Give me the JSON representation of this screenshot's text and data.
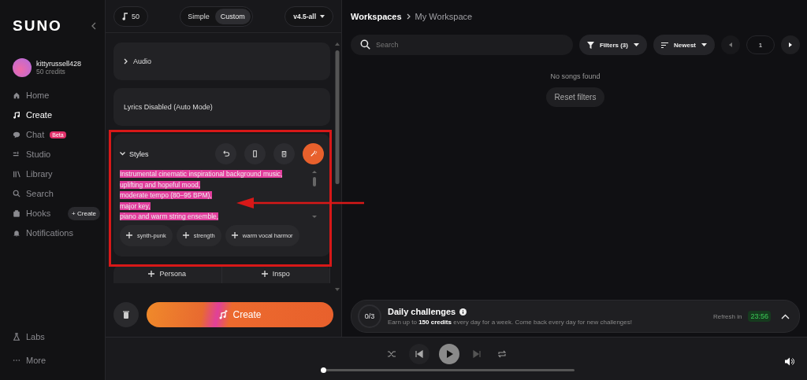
{
  "sidebar": {
    "logo": "SUNO",
    "user": {
      "name": "kittyrussell428",
      "credits": "50 credits"
    },
    "nav": [
      {
        "label": "Home",
        "selected": false
      },
      {
        "label": "Create",
        "selected": true
      },
      {
        "label": "Chat",
        "selected": false,
        "badge": "Beta"
      },
      {
        "label": "Studio",
        "selected": false
      },
      {
        "label": "Library",
        "selected": false
      },
      {
        "label": "Search",
        "selected": false
      },
      {
        "label": "Hooks",
        "selected": false,
        "action": "+ Create"
      },
      {
        "label": "Notifications",
        "selected": false
      }
    ],
    "bottom": [
      {
        "label": "Labs"
      },
      {
        "label": "More"
      }
    ]
  },
  "create_panel": {
    "credits": "50",
    "modes": [
      {
        "label": "Simple",
        "selected": false
      },
      {
        "label": "Custom",
        "selected": true
      }
    ],
    "model": "v4.5-all",
    "sections": [
      {
        "kind": "collapsible",
        "label": "Audio",
        "expanded": false
      },
      {
        "kind": "note",
        "label": "Lyrics Disabled (Auto Mode)"
      },
      {
        "kind": "styles",
        "label": "Styles",
        "expanded": true,
        "text_selected": true,
        "lines": [
          "Instrumental cinematic inspirational background music,",
          "uplifting and hopeful mood,",
          "moderate tempo (80–95 BPM),",
          "major key,",
          "piano and warm string ensemble,"
        ],
        "tags": [
          "synth-punk",
          "strength",
          "warm vocal harmor"
        ]
      }
    ],
    "extras": [
      "Persona",
      "Inspo"
    ],
    "create_button": "Create"
  },
  "workspace": {
    "breadcrumb": [
      "Workspaces",
      "My Workspace"
    ],
    "search": {
      "placeholder": "Search"
    },
    "filters": "Filters (3)",
    "sort": "Newest",
    "page": "1",
    "empty_message": "No songs found",
    "reset_button": "Reset filters"
  },
  "daily_challenges": {
    "progress": "0/3",
    "title": "Daily challenges",
    "description": "Earn up to **150 credits** every day for a week. Come back every day for new challenges!",
    "refresh_label": "Refresh in",
    "timer": "23:56"
  },
  "player": {
    "level": 0
  }
}
